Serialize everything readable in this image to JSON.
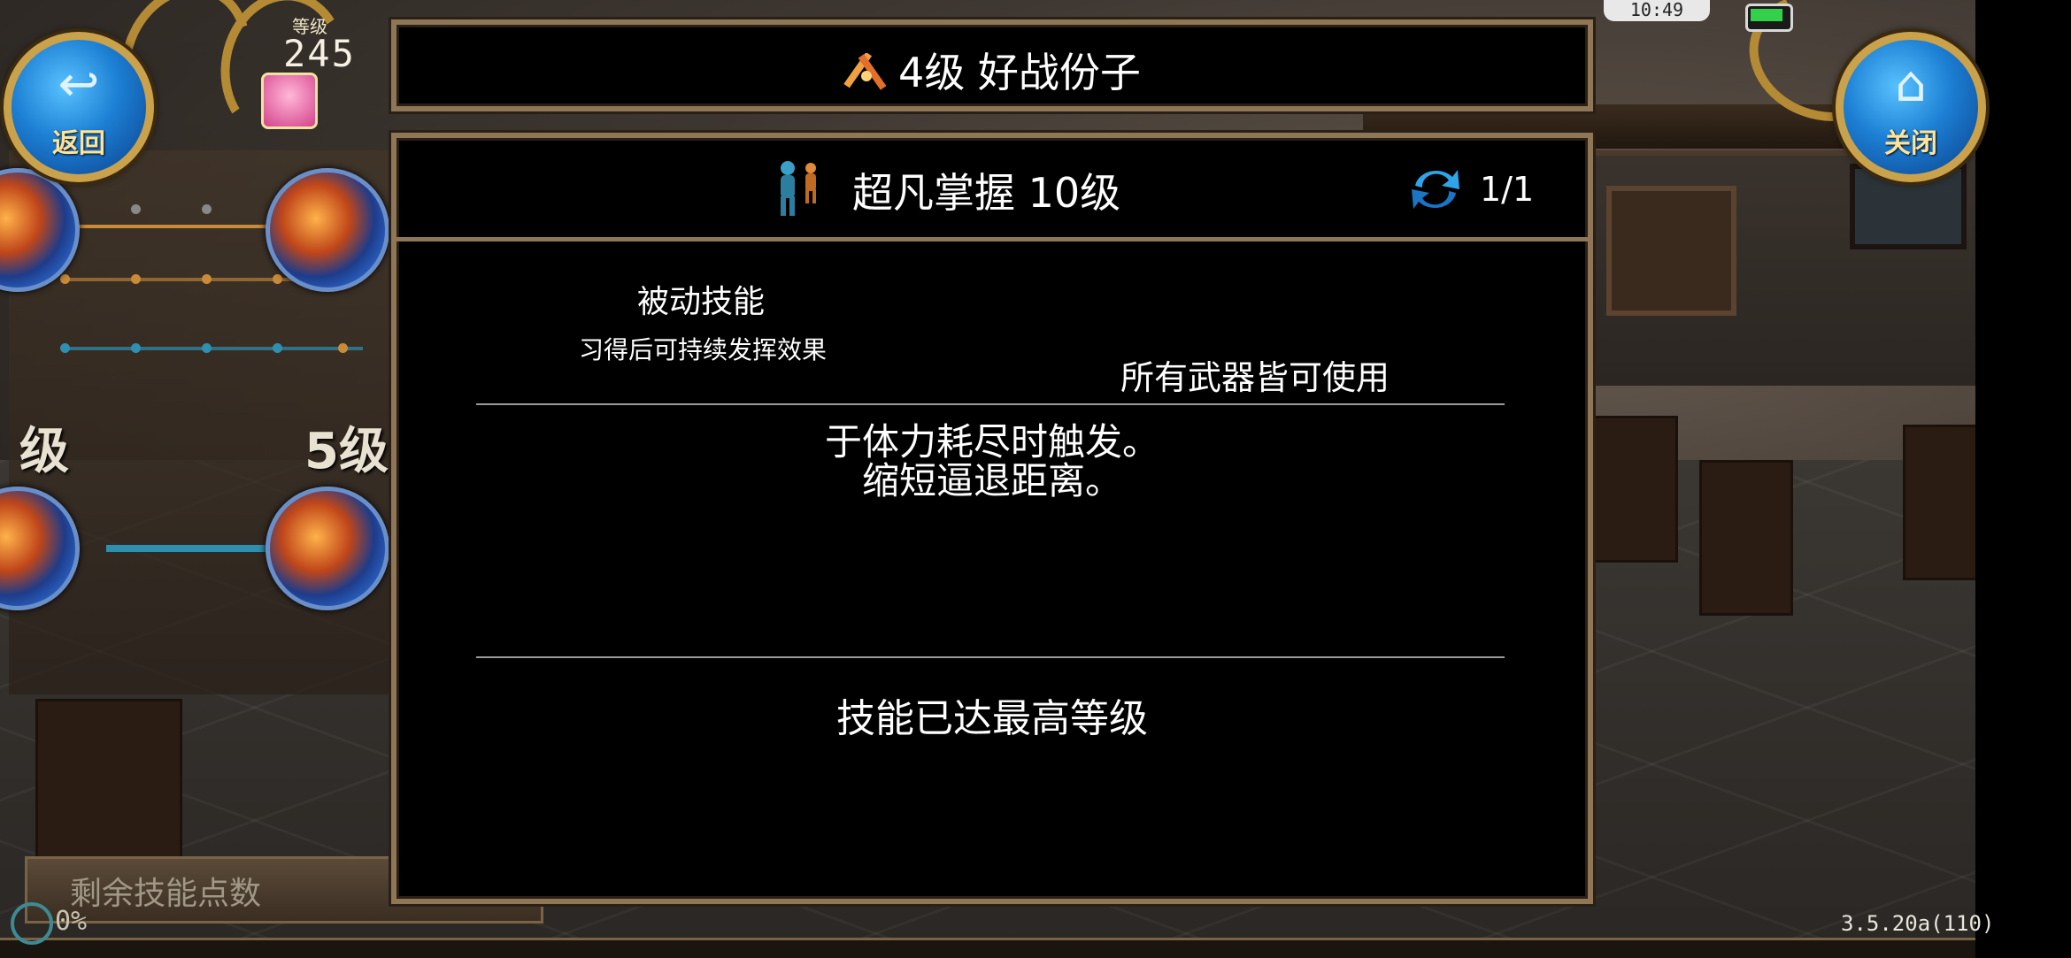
{
  "top_left": {
    "back_label": "返回",
    "level_caption": "等级",
    "level_value": "245"
  },
  "top_right": {
    "close_label": "关闭"
  },
  "status_bar": {
    "time": "10:49"
  },
  "title_bar": {
    "title": "4级  好战份子"
  },
  "skill_tree": {
    "level_label_left": "级",
    "level_label_right": "5级"
  },
  "skill_detail": {
    "skill_name": "超凡掌握  10级",
    "page_counter": "1/1",
    "skill_type": "被动技能",
    "skill_type_desc": "习得后可持续发挥效果",
    "weapon_requirement": "所有武器皆可使用",
    "effect_line1": "于体力耗尽时触发。",
    "effect_line2": "缩短逼退距离。",
    "max_level_notice": "技能已达最高等级"
  },
  "footer": {
    "remaining_points_label": "剩余技能点数",
    "xp_percent": "0%",
    "version": "3.5.20a(110)"
  },
  "colors": {
    "frame_border": "#8e7656",
    "button_blue": "#1c7fd3",
    "gold": "#c9a24b"
  }
}
